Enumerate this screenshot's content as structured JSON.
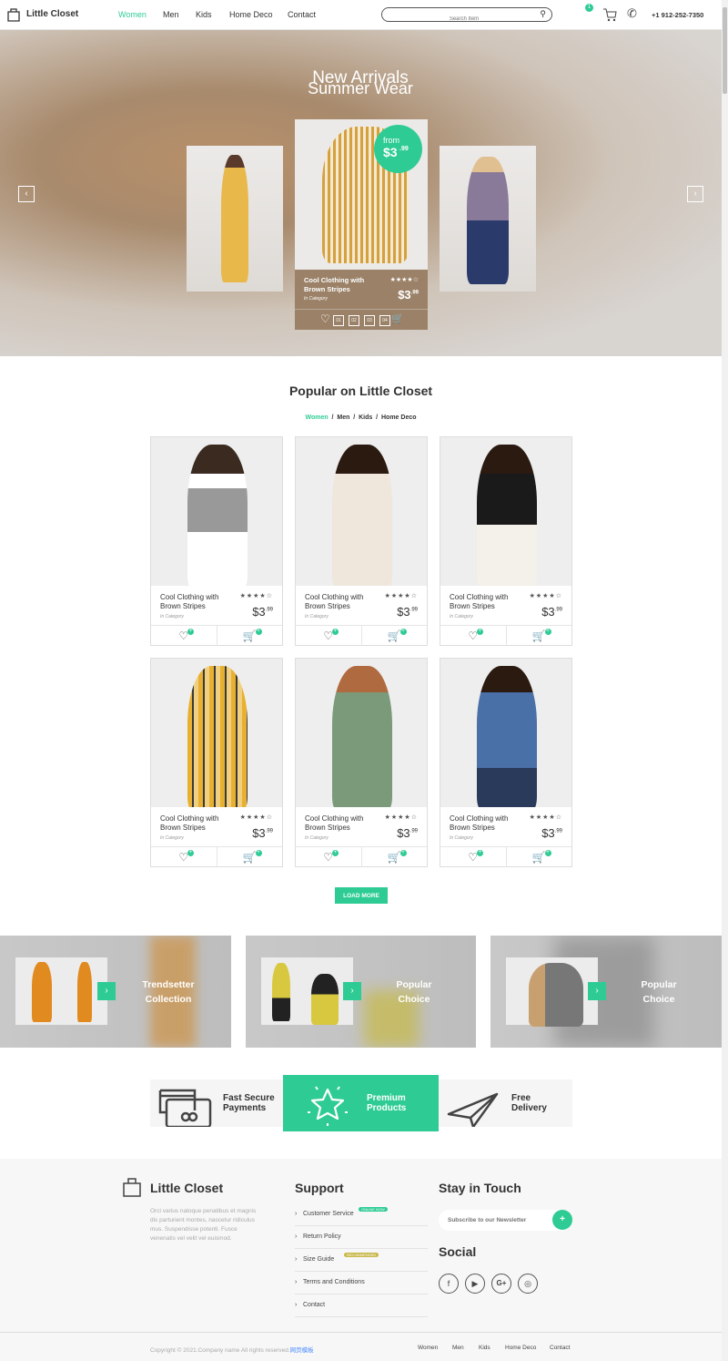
{
  "header": {
    "brand": "Little Closet",
    "nav": [
      "Women",
      "Men",
      "Kids",
      "Home Deco",
      "Contact"
    ],
    "active_nav": "Women",
    "search_placeholder": "Search Item",
    "cart_count": "1",
    "phone": "+1 912-252-7350"
  },
  "hero": {
    "title": "New Arrivals",
    "subtitle": "Summer Wear",
    "badge_from": "from",
    "badge_price": "$3",
    "badge_cents": ".99",
    "featured": {
      "name": "Cool Clothing with Brown Stripes",
      "category": "In Category",
      "rating": 4,
      "price": "$3",
      "cents": ".99"
    },
    "pages": [
      "01",
      "02",
      "03",
      "04"
    ]
  },
  "popular": {
    "title": "Popular on Little Closet",
    "filters": [
      "Women",
      "Men",
      "Kids",
      "Home Deco"
    ],
    "active_filter": "Women",
    "separator": "/",
    "products": [
      {
        "name": "Cool Clothing with Brown Stripes",
        "category": "In Category",
        "rating": 4,
        "price": "$3",
        "cents": ".99"
      },
      {
        "name": "Cool Clothing with Brown Stripes",
        "category": "In Category",
        "rating": 4,
        "price": "$3",
        "cents": ".99"
      },
      {
        "name": "Cool Clothing with Brown Stripes",
        "category": "In Category",
        "rating": 4,
        "price": "$3",
        "cents": ".99"
      },
      {
        "name": "Cool Clothing with Brown Stripes",
        "category": "In Category",
        "rating": 4,
        "price": "$3",
        "cents": ".99"
      },
      {
        "name": "Cool Clothing with Brown Stripes",
        "category": "In Category",
        "rating": 4,
        "price": "$3",
        "cents": ".99"
      },
      {
        "name": "Cool Clothing with Brown Stripes",
        "category": "In Category",
        "rating": 4,
        "price": "$3",
        "cents": ".99"
      }
    ],
    "load_more": "LOAD MORE"
  },
  "collections": [
    {
      "line1": "Trendsetter",
      "line2": "Collection"
    },
    {
      "line1": "Popular",
      "line2": "Choice"
    },
    {
      "line1": "Popular",
      "line2": "Choice"
    }
  ],
  "features": [
    {
      "line1": "Fast Secure",
      "line2": "Payments",
      "icon": "credit-card-icon"
    },
    {
      "line1": "Premium",
      "line2": "Products",
      "icon": "star-icon"
    },
    {
      "line1": "Free",
      "line2": "Delivery",
      "icon": "paper-plane-icon"
    }
  ],
  "footer": {
    "brand": "Little Closet",
    "about": "Orci varius natoque penatibus et magnis dis parturient montes, nascetur ridiculus mus. Suspendisse potenti. Fusce venenatis vel velit vel euismod.",
    "support_title": "Support",
    "support": [
      {
        "label": "Customer Service",
        "badge": "ONLINE NOW"
      },
      {
        "label": "Return Policy"
      },
      {
        "label": "Size Guide",
        "badge": "RECOMMENDED"
      },
      {
        "label": "Terms and Conditions"
      },
      {
        "label": "Contact"
      }
    ],
    "touch_title": "Stay in Touch",
    "newsletter_placeholder": "Subscribe to our Newsletter",
    "newsletter_button": "+",
    "social_title": "Social",
    "social": [
      "facebook",
      "youtube",
      "google-plus",
      "instagram"
    ],
    "copyright": "Copyright © 2021.Company name All rights reserved.",
    "copyright_link": "网页模板",
    "links": [
      "Women",
      "Men",
      "Kids",
      "Home Deco",
      "Contact"
    ]
  },
  "colors": {
    "accent": "#2ecc94",
    "text": "#333333",
    "badge_recommended": "#c8b84a"
  }
}
